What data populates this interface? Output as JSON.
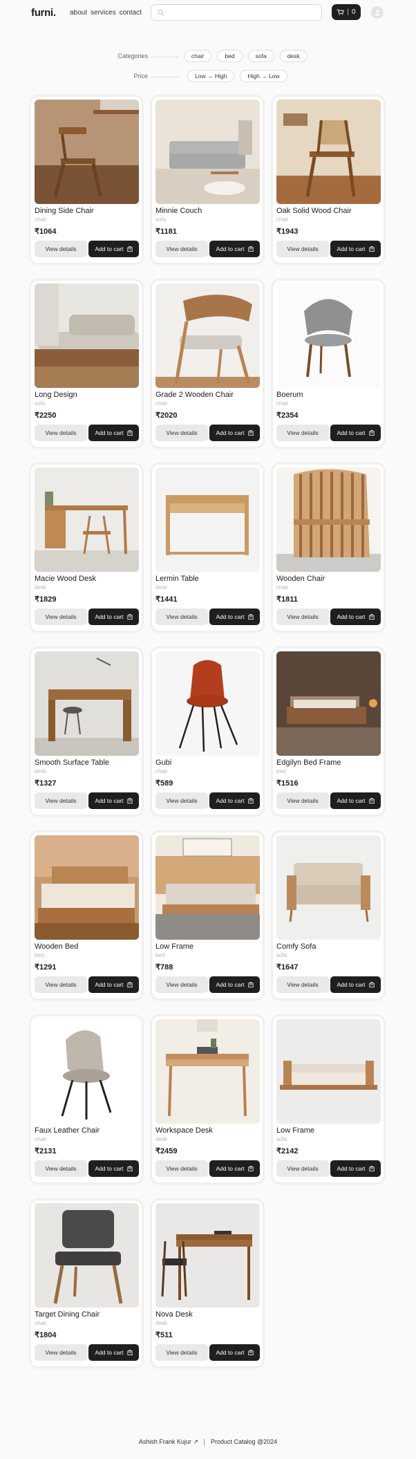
{
  "header": {
    "logo": "furni.",
    "nav": [
      "about",
      "services",
      "contact"
    ],
    "search_placeholder": "",
    "cart_separator": "|",
    "cart_count": "0"
  },
  "filters": {
    "categories_label": "Categories",
    "categories": [
      "chair",
      "bed",
      "sofa",
      "desk"
    ],
    "price_label": "Price",
    "price_options": [
      "Low → High",
      "High → Low"
    ]
  },
  "button_labels": {
    "details": "View details",
    "add_to_cart": "Add to cart"
  },
  "products": [
    {
      "name": "Dining Side Chair",
      "category": "chair",
      "price": "₹1064",
      "image": "chair-photo"
    },
    {
      "name": "Minnie Couch",
      "category": "sofa",
      "price": "₹1181",
      "image": "couch-photo"
    },
    {
      "name": "Oak Solid Wood Chair",
      "category": "chair",
      "price": "₹1943",
      "image": "chair-photo"
    },
    {
      "name": "Long Design",
      "category": "sofa",
      "price": "₹2250",
      "image": "sofa-photo"
    },
    {
      "name": "Grade 2 Wooden Chair",
      "category": "chair",
      "price": "₹2020",
      "image": "chair-photo"
    },
    {
      "name": "Boerum",
      "category": "chair",
      "price": "₹2354",
      "image": "chair-photo"
    },
    {
      "name": "Macie Wood Desk",
      "category": "desk",
      "price": "₹1829",
      "image": "desk-photo"
    },
    {
      "name": "Lermin Table",
      "category": "desk",
      "price": "₹1441",
      "image": "desk-photo"
    },
    {
      "name": "Wooden Chair",
      "category": "chair",
      "price": "₹1811",
      "image": "chair-photo"
    },
    {
      "name": "Smooth Surface Table",
      "category": "desk",
      "price": "₹1327",
      "image": "desk-photo"
    },
    {
      "name": "Gubi",
      "category": "chair",
      "price": "₹589",
      "image": "chair-photo"
    },
    {
      "name": "Edgilyn Bed Frame",
      "category": "bed",
      "price": "₹1516",
      "image": "bed-photo"
    },
    {
      "name": "Wooden Bed",
      "category": "bed",
      "price": "₹1291",
      "image": "bed-photo"
    },
    {
      "name": "Low Frame",
      "category": "bed",
      "price": "₹788",
      "image": "bed-photo"
    },
    {
      "name": "Comfy Sofa",
      "category": "sofa",
      "price": "₹1647",
      "image": "sofa-photo"
    },
    {
      "name": "Faux Leather Chair",
      "category": "chair",
      "price": "₹2131",
      "image": "chair-photo"
    },
    {
      "name": "Workspace Desk",
      "category": "desk",
      "price": "₹2459",
      "image": "desk-photo"
    },
    {
      "name": "Low Frame",
      "category": "sofa",
      "price": "₹2142",
      "image": "sofa-photo"
    },
    {
      "name": "Target Dining Chair",
      "category": "chair",
      "price": "₹1804",
      "image": "chair-photo"
    },
    {
      "name": "Nova Desk",
      "category": "desk",
      "price": "₹511",
      "image": "desk-photo"
    }
  ],
  "footer": {
    "author": "Ashish Frank Kujur",
    "arrow": "↗",
    "right": "Product Catalog  @2024"
  }
}
